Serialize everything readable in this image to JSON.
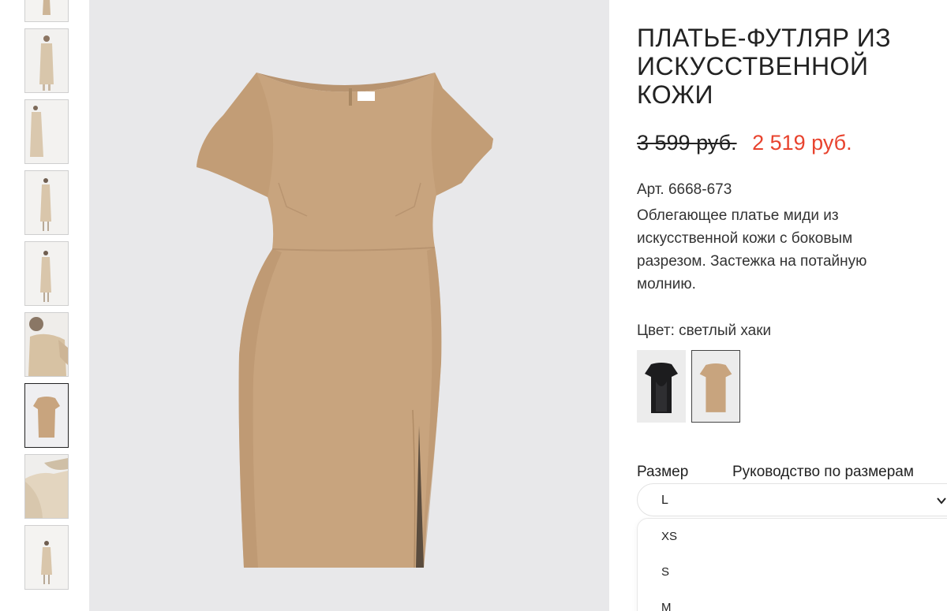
{
  "product": {
    "title": "ПЛАТЬЕ-ФУТЛЯР ИЗ ИСКУССТВЕННОЙ КОЖИ",
    "old_price": "3 599 руб.",
    "new_price": "2 519 руб.",
    "sku": "Арт. 6668-673",
    "description": "Облегающее платье миди из искусственной кожи с боковым разрезом. Застежка на потайную молнию."
  },
  "color": {
    "label": "Цвет: светлый хаки",
    "swatches": [
      {
        "name": "black",
        "hex": "#1c1c1e",
        "selected": false
      },
      {
        "name": "light-khaki",
        "hex": "#c8a47e",
        "selected": true
      }
    ]
  },
  "size": {
    "label": "Размер",
    "guide_link": "Руководство по размерам",
    "selected": "L",
    "options": [
      "XS",
      "S",
      "M"
    ]
  },
  "thumbnails": [
    {
      "name": "thumb-1",
      "active": false
    },
    {
      "name": "thumb-2",
      "active": false
    },
    {
      "name": "thumb-3",
      "active": false
    },
    {
      "name": "thumb-4",
      "active": false
    },
    {
      "name": "thumb-5",
      "active": false
    },
    {
      "name": "thumb-6",
      "active": false
    },
    {
      "name": "thumb-7",
      "active": true
    },
    {
      "name": "thumb-8",
      "active": false
    },
    {
      "name": "thumb-9",
      "active": false
    }
  ],
  "colors": {
    "sale_price": "#e8432e",
    "dress": "#c8a47e",
    "image_bg": "#e8e8ea"
  },
  "icons": {
    "select_arrow": "chevron-down-icon"
  }
}
